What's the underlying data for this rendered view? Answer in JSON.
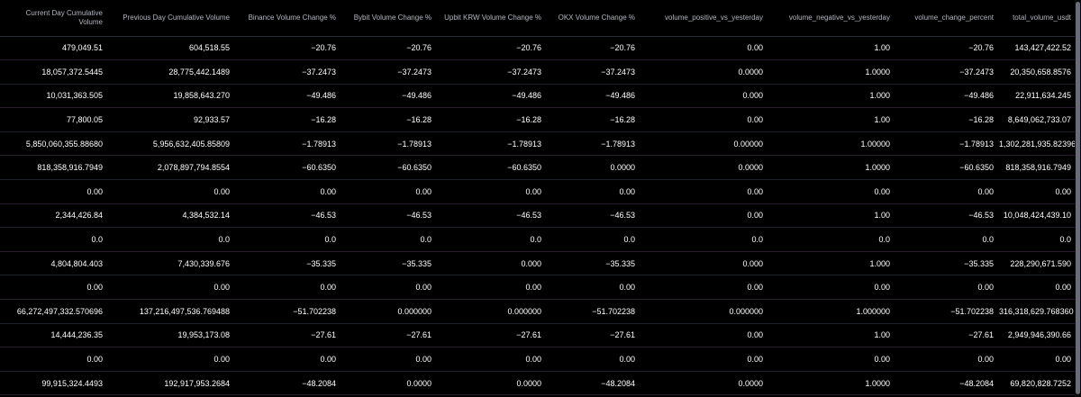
{
  "table": {
    "headers": [
      "Current Day Cumulative Volume",
      "Previous Day Cumulative Volume",
      "Binance Volume Change %",
      "Bybit Volume Change %",
      "Upbit KRW Volume Change %",
      "OKX Volume Change %",
      "volume_positive_vs_yesterday",
      "volume_negative_vs_yesterday",
      "volume_change_percent",
      "total_volume_usdt"
    ],
    "rows": [
      [
        "479,049.51",
        "604,518.55",
        "−20.76",
        "−20.76",
        "−20.76",
        "−20.76",
        "0.00",
        "1.00",
        "−20.76",
        "143,427,422.52"
      ],
      [
        "18,057,372.5445",
        "28,775,442.1489",
        "−37.2473",
        "−37.2473",
        "−37.2473",
        "−37.2473",
        "0.0000",
        "1.0000",
        "−37.2473",
        "20,350,658.8576"
      ],
      [
        "10,031,363.505",
        "19,858,643.270",
        "−49.486",
        "−49.486",
        "−49.486",
        "−49.486",
        "0.000",
        "1.000",
        "−49.486",
        "22,911,634.245"
      ],
      [
        "77,800.05",
        "92,933.57",
        "−16.28",
        "−16.28",
        "−16.28",
        "−16.28",
        "0.00",
        "1.00",
        "−16.28",
        "8,649,062,733.07"
      ],
      [
        "5,850,060,355.88680",
        "5,956,632,405.85809",
        "−1.78913",
        "−1.78913",
        "−1.78913",
        "−1.78913",
        "0.00000",
        "1.00000",
        "−1.78913",
        "1,302,281,935.82396"
      ],
      [
        "818,358,916.7949",
        "2,078,897,794.8554",
        "−60.6350",
        "−60.6350",
        "−60.6350",
        "0.0000",
        "0.0000",
        "1.0000",
        "−60.6350",
        "818,358,916.7949"
      ],
      [
        "0.00",
        "0.00",
        "0.00",
        "0.00",
        "0.00",
        "0.00",
        "0.00",
        "0.00",
        "0.00",
        "0.00"
      ],
      [
        "2,344,426.84",
        "4,384,532.14",
        "−46.53",
        "−46.53",
        "−46.53",
        "−46.53",
        "0.00",
        "1.00",
        "−46.53",
        "10,048,424,439.10"
      ],
      [
        "0.0",
        "0.0",
        "0.0",
        "0.0",
        "0.0",
        "0.0",
        "0.0",
        "0.0",
        "0.0",
        "0.0"
      ],
      [
        "4,804,804.403",
        "7,430,339.676",
        "−35.335",
        "−35.335",
        "0.000",
        "−35.335",
        "0.000",
        "1.000",
        "−35.335",
        "228,290,671.590"
      ],
      [
        "0.00",
        "0.00",
        "0.00",
        "0.00",
        "0.00",
        "0.00",
        "0.00",
        "0.00",
        "0.00",
        "0.00"
      ],
      [
        "66,272,497,332.570696",
        "137,216,497,536.769488",
        "−51.702238",
        "0.000000",
        "0.000000",
        "−51.702238",
        "0.000000",
        "1.000000",
        "−51.702238",
        "316,318,629.768360"
      ],
      [
        "14,444,236.35",
        "19,953,173.08",
        "−27.61",
        "−27.61",
        "−27.61",
        "−27.61",
        "0.00",
        "1.00",
        "−27.61",
        "2,949,946,390.66"
      ],
      [
        "0.00",
        "0.00",
        "0.00",
        "0.00",
        "0.00",
        "0.00",
        "0.00",
        "0.00",
        "0.00",
        "0.00"
      ],
      [
        "99,915,324.4493",
        "192,917,953.2684",
        "−48.2084",
        "0.0000",
        "0.0000",
        "−48.2084",
        "0.0000",
        "1.0000",
        "−48.2084",
        "69,820,828.7252"
      ]
    ]
  },
  "colors": {
    "background": "#000000",
    "text": "#ffffff",
    "header_text": "#b2b5be",
    "row_divider": "#2a1a2e",
    "scrollbar_thumb": "#6a6d78"
  }
}
